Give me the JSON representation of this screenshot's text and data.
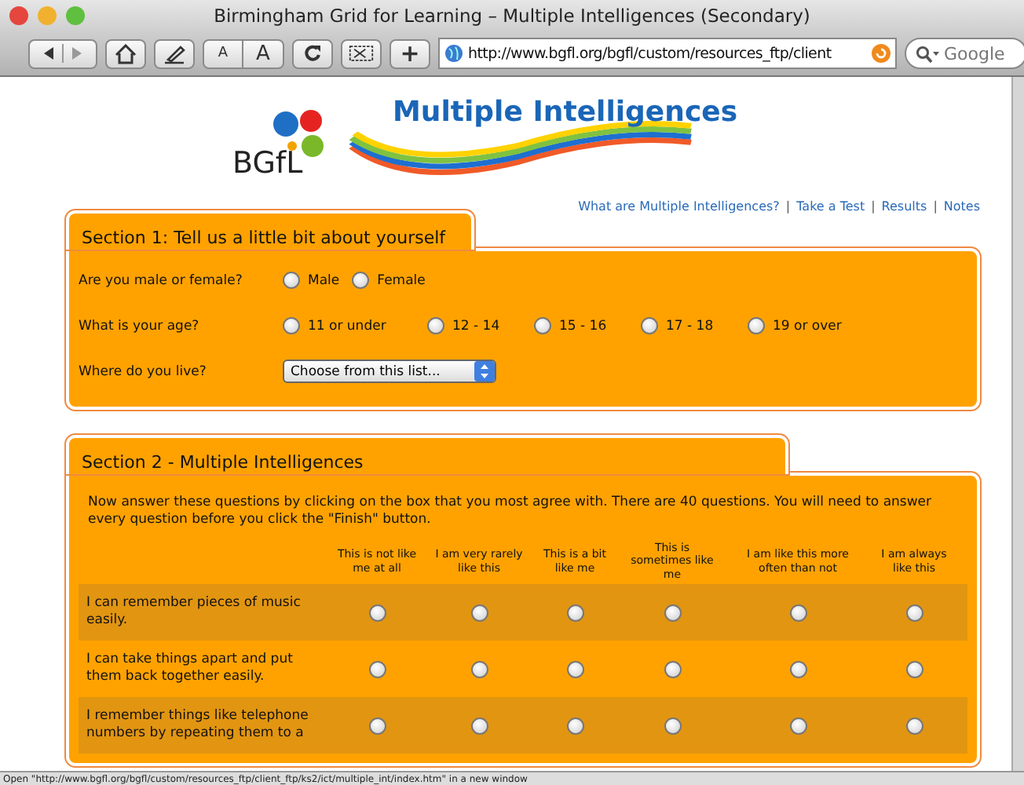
{
  "window": {
    "title": "Birmingham Grid for Learning – Multiple Intelligences (Secondary)"
  },
  "toolbar": {
    "url": "http://www.bgfl.org/bgfl/custom/resources_ftp/client",
    "search_placeholder": "Google",
    "text_buttons": [
      "A",
      "A",
      "+"
    ]
  },
  "logo": {
    "brand": "BGfL",
    "title": "Multiple Intelligences"
  },
  "nav_links": [
    "What are Multiple Intelligences?",
    "Take a Test",
    "Results",
    "Notes"
  ],
  "nav_separator": "|",
  "section1": {
    "title": "Section 1: Tell us a little bit about yourself",
    "questions": [
      {
        "kind": "radio",
        "label": "Are you male or female?",
        "options": [
          {
            "label": "Male",
            "selected": false
          },
          {
            "label": "Female",
            "selected": false
          }
        ]
      },
      {
        "kind": "radio",
        "label": "What is your age?",
        "options": [
          {
            "label": "11 or under",
            "selected": false
          },
          {
            "label": "12 - 14",
            "selected": false
          },
          {
            "label": "15 - 16",
            "selected": false
          },
          {
            "label": "17 - 18",
            "selected": false
          },
          {
            "label": "19 or over",
            "selected": false
          }
        ]
      },
      {
        "kind": "select",
        "label": "Where do you live?",
        "value": "Choose from this list..."
      }
    ]
  },
  "section2": {
    "title": "Section 2 - Multiple Intelligences",
    "intro": "Now answer these questions by clicking on the box that you most agree with. There are 40 questions. You will need to answer every question before you click the \"Finish\" button.",
    "columns": [
      "This is not like me at all",
      "I am very rarely like this",
      "This is a bit like me",
      "This is sometimes like me",
      "I am like this more often than not",
      "I am always like this"
    ],
    "rows": [
      {
        "question": "I can remember pieces of music easily.",
        "answers": [
          false,
          false,
          false,
          false,
          false,
          false
        ]
      },
      {
        "question": "I can take things apart and put them back together easily.",
        "answers": [
          false,
          false,
          false,
          false,
          false,
          false
        ]
      },
      {
        "question": "I remember things like telephone numbers by repeating them to a",
        "answers": [
          false,
          false,
          false,
          false,
          false,
          false
        ]
      }
    ]
  },
  "status_bar": "Open \"http://www.bgfl.org/bgfl/custom/resources_ftp/client_ftp/ks2/ict/multiple_int/index.htm\" in a new window"
}
